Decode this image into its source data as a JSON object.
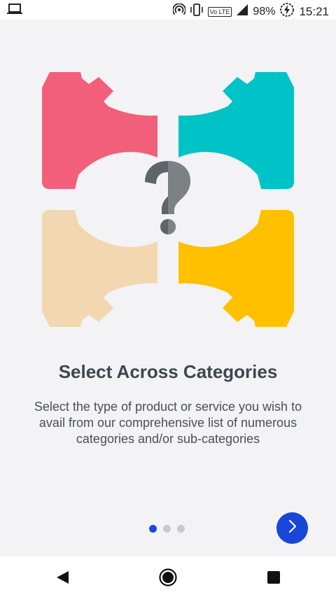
{
  "status_bar": {
    "left_icon": "laptop-icon",
    "volte_badge": "Vo LTE",
    "battery_percent": "98%",
    "time": "15:21",
    "icons": [
      "hotspot-icon",
      "vibrate-icon",
      "volte-icon",
      "signal-icon",
      "battery-saver-icon"
    ]
  },
  "illustration": {
    "icon": "categories-arrows-question-icon",
    "colors": {
      "top_left": "#F25F7A",
      "top_right": "#00C3C7",
      "bottom_left": "#F2D7B0",
      "bottom_right": "#FFC000",
      "question_dark": "#5F6469",
      "question_light": "#7C8186"
    }
  },
  "onboarding": {
    "title": "Select Across Categories",
    "description": "Select the type of product or service you wish to avail from our comprehensive list of numerous categories and/or sub-categories"
  },
  "pager": {
    "total_pages": 3,
    "current_page": 1,
    "active_color": "#1747D8",
    "inactive_color": "#C9C9CC"
  },
  "next_button": {
    "icon": "chevron-right-icon",
    "color": "#1747D8"
  },
  "nav_bar": {
    "back": "back-icon",
    "home": "home-icon",
    "recents": "recents-icon"
  }
}
